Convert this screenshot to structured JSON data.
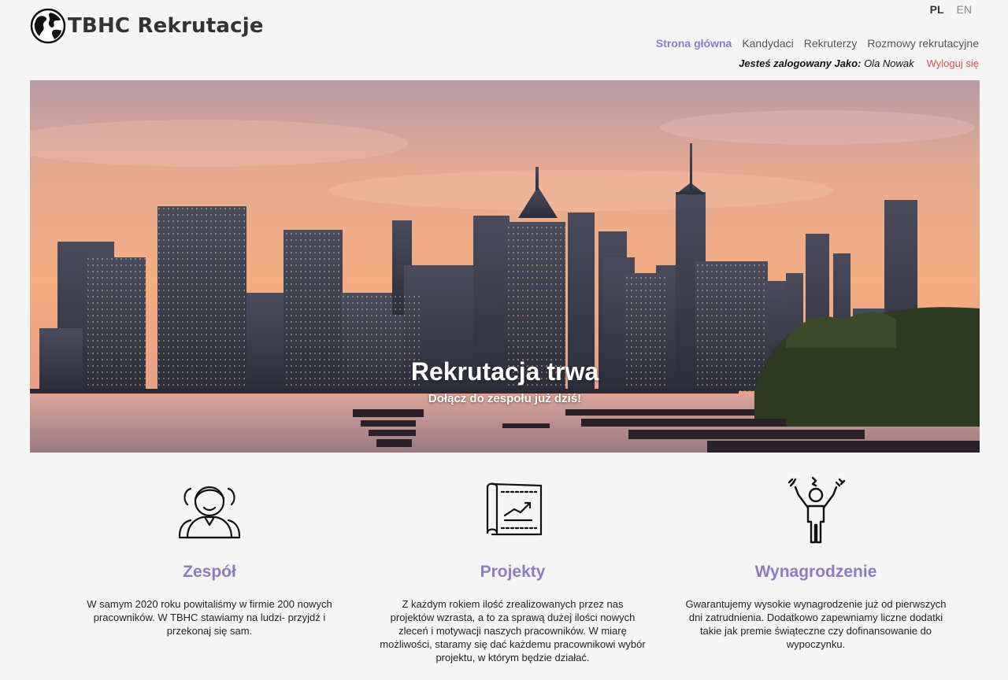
{
  "brand": {
    "name": "TBHC Rekrutacje",
    "logo_icon": "globe-icon"
  },
  "languages": [
    {
      "label": "PL",
      "active": true
    },
    {
      "label": "EN",
      "active": false
    }
  ],
  "nav": {
    "items": [
      {
        "label": "Strona główna",
        "active": true
      },
      {
        "label": "Kandydaci",
        "active": false
      },
      {
        "label": "Rekruterzy",
        "active": false
      },
      {
        "label": "Rozmowy rekrutacyjne",
        "active": false
      }
    ]
  },
  "user": {
    "prefix": "Jesteś zalogowany Jako:",
    "name": "Ola Nowak",
    "logout": "Wyloguj się"
  },
  "hero": {
    "title": "Rekrutacja trwa",
    "subtitle": "Dołącz do zespołu już dziś!"
  },
  "features": [
    {
      "icon": "team-icon",
      "title": "Zespół",
      "text": "W samym 2020 roku powitaliśmy w firmie 200 nowych pracowników. W TBHC stawiamy na ludzi- przyjdź i przekonaj się sam."
    },
    {
      "icon": "projects-chart-icon",
      "title": "Projekty",
      "text": "Z każdym rokiem ilość zrealizowanych przez nas projektów wzrasta, a to za sprawą dużej ilości nowych zleceń i motywacji naszych pracowników. W miarę możliwości, staramy się dać każdemu pracownikowi wybór projektu, w którym będzie działać."
    },
    {
      "icon": "happy-person-icon",
      "title": "Wynagrodzenie",
      "text": "Gwarantujemy wysokie wynagrodzenie już od pierwszych dni zatrudnienia. Dodatkowo zapewniamy liczne dodatki takie jak premie świąteczne czy dofinansowanie do wypoczynku."
    }
  ],
  "colors": {
    "accent": "#8e7cc3",
    "logout": "#d9534f",
    "background": "#f5f5f5"
  }
}
